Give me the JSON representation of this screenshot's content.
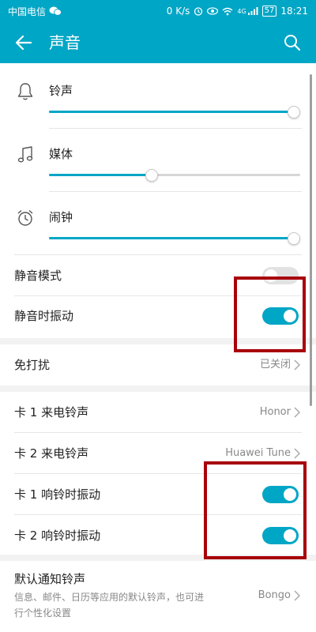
{
  "status_bar": {
    "carrier": "中国电信",
    "network_speed": "0 K/s",
    "network_type": "4G",
    "battery": "57",
    "time": "18:21"
  },
  "header": {
    "title": "声音"
  },
  "volumes": [
    {
      "label": "铃声",
      "icon": "bell-icon",
      "level_percent": 100
    },
    {
      "label": "媒体",
      "icon": "music-note-icon",
      "level_percent": 41
    },
    {
      "label": "闹钟",
      "icon": "alarm-clock-icon",
      "level_percent": 100
    }
  ],
  "silent_mode": {
    "label": "静音模式",
    "enabled": false
  },
  "vibrate_silent": {
    "label": "静音时振动",
    "enabled": true
  },
  "do_not_disturb": {
    "label": "免打扰",
    "value": "已关闭"
  },
  "sim1_ringtone": {
    "label": "卡 1 来电铃声",
    "value": "Honor"
  },
  "sim2_ringtone": {
    "label": "卡 2 来电铃声",
    "value": "Huawei Tune"
  },
  "sim1_vibrate": {
    "label": "卡 1 响铃时振动",
    "enabled": true
  },
  "sim2_vibrate": {
    "label": "卡 2 响铃时振动",
    "enabled": true
  },
  "notification_ringtone": {
    "label": "默认通知铃声",
    "description": "信息、邮件、日历等应用的默认铃声，也可进行个性化设置",
    "value": "Bongo"
  },
  "colors": {
    "accent": "#00a6c6",
    "highlight": "#a8000c"
  }
}
